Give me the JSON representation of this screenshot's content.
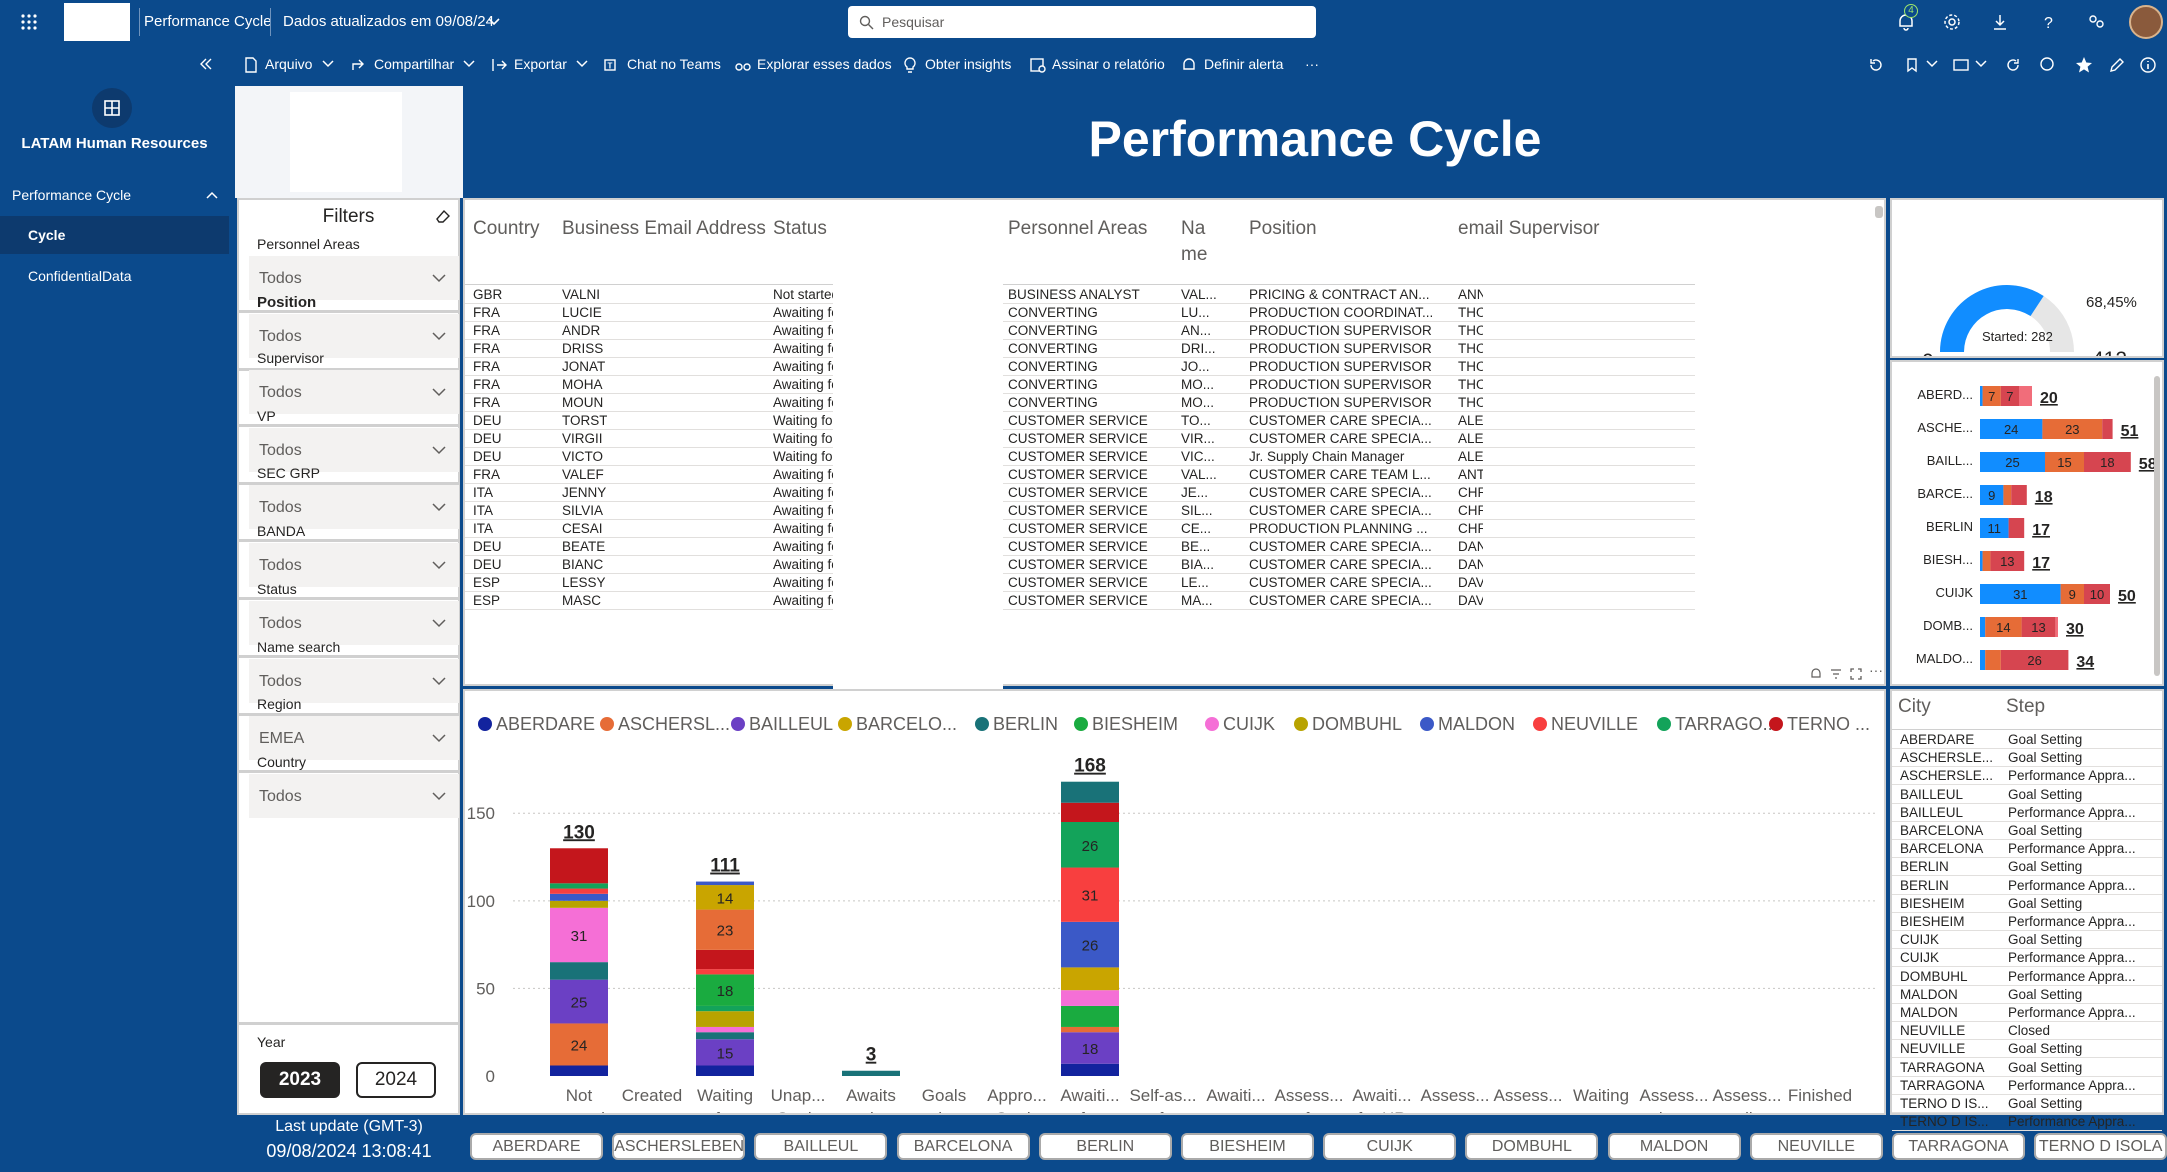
{
  "topbar": {
    "app_name": "Performance Cycle",
    "data_updated": "Dados atualizados em 09/08/24",
    "search_placeholder": "Pesquisar",
    "notification_count": "4"
  },
  "command_bar": {
    "items": [
      "Arquivo",
      "Compartilhar",
      "Exportar",
      "Chat no Teams",
      "Explorar esses dados",
      "Obter insights",
      "Assinar o relatório",
      "Definir alerta",
      "···"
    ]
  },
  "left_nav": {
    "workspace": "LATAM Human Resources",
    "section": "Performance Cycle",
    "pages": [
      "Cycle",
      "ConfidentialData"
    ]
  },
  "report": {
    "title": "Performance Cycle",
    "filters_title": "Filters",
    "filters": [
      {
        "label": "Personnel Areas",
        "value": "Todos"
      },
      {
        "label": "Position",
        "value": "Todos"
      },
      {
        "label": "Supervisor",
        "value": "Todos"
      },
      {
        "label": "VP",
        "value": "Todos"
      },
      {
        "label": "SEC GRP",
        "value": "Todos"
      },
      {
        "label": "BANDA",
        "value": "Todos"
      },
      {
        "label": "Status",
        "value": "Todos"
      },
      {
        "label": "Name search",
        "value": "Todos"
      },
      {
        "label": "Region",
        "value": "EMEA"
      },
      {
        "label": "Country",
        "value": "Todos"
      }
    ],
    "year_label": "Year",
    "years": [
      "2023",
      "2024"
    ],
    "selected_year": "2023",
    "last_update_label": "Last update (GMT-3)",
    "last_update_value": "09/08/2024 13:08:41"
  },
  "employee_table": {
    "columns": [
      "Country",
      "Business Email Address",
      "Status",
      "Personnel Areas",
      "Na me",
      "Position",
      "email Supervisor"
    ],
    "rows": [
      [
        "GBR",
        "VALNI",
        "Not started",
        "BUSINESS ANALYST",
        "VAL...",
        "PRICING & CONTRACT AN...",
        "ANN"
      ],
      [
        "FRA",
        "LUCIE",
        "Awaiting for self-assessment",
        "CONVERTING",
        "LU...",
        "PRODUCTION COORDINAT...",
        "THO"
      ],
      [
        "FRA",
        "ANDR",
        "Awaiting for self-assessment",
        "CONVERTING",
        "AN...",
        "PRODUCTION SUPERVISOR",
        "THO"
      ],
      [
        "FRA",
        "DRISS",
        "Awaiting for self-assessment",
        "CONVERTING",
        "DRI...",
        "PRODUCTION SUPERVISOR",
        "THO"
      ],
      [
        "FRA",
        "JONAT",
        "Awaiting for self-assessment",
        "CONVERTING",
        "JO...",
        "PRODUCTION SUPERVISOR",
        "THO"
      ],
      [
        "FRA",
        "MOHA",
        "Awaiting for self-assessment",
        "CONVERTING",
        "MO...",
        "PRODUCTION SUPERVISOR",
        "THO"
      ],
      [
        "FRA",
        "MOUN",
        "Awaiting for self-assessment",
        "CONVERTING",
        "MO...",
        "PRODUCTION SUPERVISOR",
        "THO"
      ],
      [
        "DEU",
        "TORST",
        "Waiting for manager approval",
        "CUSTOMER SERVICE",
        "TO...",
        "CUSTOMER CARE SPECIA...",
        "ALE"
      ],
      [
        "DEU",
        "VIRGII",
        "Waiting for manager approval",
        "CUSTOMER SERVICE",
        "VIR...",
        "CUSTOMER CARE SPECIA...",
        "ALE"
      ],
      [
        "DEU",
        "VICTO",
        "Waiting for manager approval",
        "CUSTOMER SERVICE",
        "VIC...",
        "Jr. Supply Chain Manager",
        "ALE"
      ],
      [
        "FRA",
        "VALEF",
        "Awaiting for self-assessment",
        "CUSTOMER SERVICE",
        "VAL...",
        "CUSTOMER CARE TEAM L...",
        "ANT"
      ],
      [
        "ITA",
        "JENNY",
        "Awaiting for self-assessment",
        "CUSTOMER SERVICE",
        "JE...",
        "CUSTOMER CARE SPECIA...",
        "CHR"
      ],
      [
        "ITA",
        "SILVIA",
        "Awaiting for self-assessment",
        "CUSTOMER SERVICE",
        "SIL...",
        "CUSTOMER CARE SPECIA...",
        "CHR"
      ],
      [
        "ITA",
        "CESAI",
        "Awaiting for self-assessment",
        "CUSTOMER SERVICE",
        "CE...",
        "PRODUCTION PLANNING ...",
        "CHR"
      ],
      [
        "DEU",
        "BEATE",
        "Awaiting for self-assessment",
        "CUSTOMER SERVICE",
        "BE...",
        "CUSTOMER CARE SPECIA...",
        "DAN"
      ],
      [
        "DEU",
        "BIANC",
        "Awaiting for self-assessment",
        "CUSTOMER SERVICE",
        "BIA...",
        "CUSTOMER CARE SPECIA...",
        "DAN"
      ],
      [
        "ESP",
        "LESSY",
        "Awaiting for self-assessment",
        "CUSTOMER SERVICE",
        "LE...",
        "CUSTOMER CARE SPECIA...",
        "DAV"
      ],
      [
        "ESP",
        "MASC",
        "Awaiting for self-assessment",
        "CUSTOMER SERVICE",
        "MA...",
        "CUSTOMER CARE SPECIA...",
        "DAV"
      ]
    ]
  },
  "gauge": {
    "value": 282,
    "label": "Started: 282",
    "min": "0",
    "max": "412",
    "percent": "68,45%",
    "fraction": 0.6845,
    "color": "#118dff"
  },
  "city_bars": [
    {
      "city": "ABERD...",
      "total": "20",
      "segments": [
        {
          "v": 1,
          "label": ""
        },
        {
          "v": 7,
          "label": "7"
        },
        {
          "v": 7,
          "label": "7"
        },
        {
          "v": 5,
          "label": ""
        }
      ]
    },
    {
      "city": "ASCHE...",
      "total": "51",
      "segments": [
        {
          "v": 24,
          "label": "24"
        },
        {
          "v": 23,
          "label": "23"
        },
        {
          "v": 4,
          "label": ""
        }
      ]
    },
    {
      "city": "BAILL...",
      "total": "58",
      "segments": [
        {
          "v": 25,
          "label": "25"
        },
        {
          "v": 15,
          "label": "15"
        },
        {
          "v": 18,
          "label": "18"
        }
      ]
    },
    {
      "city": "BARCE...",
      "total": "18",
      "segments": [
        {
          "v": 9,
          "label": "9"
        },
        {
          "v": 3,
          "label": ""
        },
        {
          "v": 6,
          "label": ""
        }
      ]
    },
    {
      "city": "BERLIN",
      "total": "17",
      "segments": [
        {
          "v": 11,
          "label": "11"
        },
        {
          "v": 6,
          "label": ""
        }
      ]
    },
    {
      "city": "BIESH...",
      "total": "17",
      "segments": [
        {
          "v": 1,
          "label": ""
        },
        {
          "v": 3,
          "label": ""
        },
        {
          "v": 13,
          "label": "13"
        }
      ]
    },
    {
      "city": "CUIJK",
      "total": "50",
      "segments": [
        {
          "v": 31,
          "label": "31"
        },
        {
          "v": 9,
          "label": "9"
        },
        {
          "v": 10,
          "label": "10"
        }
      ]
    },
    {
      "city": "DOMB...",
      "total": "30",
      "segments": [
        {
          "v": 2,
          "label": ""
        },
        {
          "v": 14,
          "label": "14"
        },
        {
          "v": 13,
          "label": "13"
        },
        {
          "v": 1,
          "label": ""
        }
      ]
    },
    {
      "city": "MALDO...",
      "total": "34",
      "segments": [
        {
          "v": 2,
          "label": ""
        },
        {
          "v": 6,
          "label": ""
        },
        {
          "v": 26,
          "label": "26"
        }
      ]
    }
  ],
  "city_bar_colors": [
    "#118dff",
    "#e66c37",
    "#d64550",
    "#f16d7a"
  ],
  "chart_data": {
    "type": "bar",
    "stacked": true,
    "legend_position": "top",
    "series_names": [
      "ABERDARE",
      "ASCHERSL...",
      "BAILLEUL",
      "BARCELO...",
      "BERLIN",
      "BIESHEIM",
      "CUIJK",
      "DOMBUHL",
      "MALDON",
      "NEUVILLE",
      "TARRAGO...",
      "TERNO ..."
    ],
    "series_colors": [
      "#12239e",
      "#e66c37",
      "#6b40c4",
      "#c9a500",
      "#197278",
      "#1aab40",
      "#f56fd6",
      "#b8a300",
      "#3b59c7",
      "#f83f3f",
      "#13a35a",
      "#c4161c"
    ],
    "categories": [
      "Not started",
      "Created",
      "Waiting for mana... appro...",
      "Unap... Goals",
      "Awaits review of goals by em...",
      "Goals redone by the emplo...",
      "Appro... Goals",
      "Awaiti... for self-as...",
      "Self-as... perfor... by the emplo...",
      "Awaiti... assess... by mana...",
      "Assess... perfor... by mana...",
      "Awaiti... for HR appro...",
      "Assess... unapp... by HR",
      "Assess... appro... by HR",
      "Waiting mana... release",
      "Assess... releas... by mana...",
      "Assess... availa... for emplo...",
      "Finished"
    ],
    "totals": [
      130,
      0,
      111,
      0,
      3,
      0,
      0,
      168,
      0,
      0,
      0,
      0,
      0,
      0,
      0,
      0,
      0,
      0
    ],
    "stacks": {
      "0": [
        [
          0,
          6
        ],
        [
          1,
          24
        ],
        [
          2,
          25
        ],
        [
          4,
          10
        ],
        [
          6,
          31
        ],
        [
          7,
          4
        ],
        [
          8,
          4
        ],
        [
          9,
          3
        ],
        [
          10,
          3
        ],
        [
          11,
          20
        ]
      ],
      "2": [
        [
          0,
          6
        ],
        [
          2,
          15
        ],
        [
          4,
          4
        ],
        [
          6,
          3
        ],
        [
          7,
          9
        ],
        [
          10,
          3
        ],
        [
          5,
          18
        ],
        [
          9,
          3
        ],
        [
          11,
          11
        ],
        [
          1,
          23
        ],
        [
          3,
          14
        ],
        [
          8,
          2
        ]
      ],
      "4": [
        [
          4,
          3
        ]
      ],
      "7": [
        [
          0,
          7
        ],
        [
          2,
          18
        ],
        [
          1,
          3
        ],
        [
          5,
          12
        ],
        [
          6,
          9
        ],
        [
          3,
          13
        ],
        [
          8,
          26
        ],
        [
          9,
          31
        ],
        [
          10,
          26
        ],
        [
          11,
          11
        ],
        [
          4,
          12
        ]
      ]
    },
    "segment_labels": {
      "0": {
        "1": "24",
        "2": "25",
        "6": "31"
      },
      "2": {
        "2": "15",
        "3": "14",
        "5": "18",
        "1": "23"
      },
      "7": {
        "2": "18",
        "8": "26",
        "9": "31",
        "10": "26"
      }
    },
    "yticks": [
      0,
      50,
      100,
      150
    ],
    "ylim": [
      0,
      175
    ],
    "grid": true
  },
  "city_step_table": {
    "columns": [
      "City",
      "Step"
    ],
    "rows": [
      [
        "ABERDARE",
        "Goal Setting"
      ],
      [
        "ASCHERSLE...",
        "Goal Setting"
      ],
      [
        "ASCHERSLE...",
        "Performance Appra..."
      ],
      [
        "BAILLEUL",
        "Goal Setting"
      ],
      [
        "BAILLEUL",
        "Performance Appra..."
      ],
      [
        "BARCELONA",
        "Goal Setting"
      ],
      [
        "BARCELONA",
        "Performance Appra..."
      ],
      [
        "BERLIN",
        "Goal Setting"
      ],
      [
        "BERLIN",
        "Performance Appra..."
      ],
      [
        "BIESHEIM",
        "Goal Setting"
      ],
      [
        "BIESHEIM",
        "Performance Appra..."
      ],
      [
        "CUIJK",
        "Goal Setting"
      ],
      [
        "CUIJK",
        "Performance Appra..."
      ],
      [
        "DOMBUHL",
        "Performance Appra..."
      ],
      [
        "MALDON",
        "Goal Setting"
      ],
      [
        "MALDON",
        "Performance Appra..."
      ],
      [
        "NEUVILLE",
        "Closed"
      ],
      [
        "NEUVILLE",
        "Goal Setting"
      ],
      [
        "TARRAGONA",
        "Goal Setting"
      ],
      [
        "TARRAGONA",
        "Performance Appra..."
      ],
      [
        "TERNO D IS...",
        "Goal Setting"
      ],
      [
        "TERNO D IS...",
        "Performance Appra..."
      ]
    ]
  },
  "city_buttons": [
    "ABERDARE",
    "ASCHERSLEBEN",
    "BAILLEUL",
    "BARCELONA",
    "BERLIN",
    "BIESHEIM",
    "CUIJK",
    "DOMBUHL",
    "MALDON",
    "NEUVILLE",
    "TARRAGONA",
    "TERNO D ISOLA"
  ]
}
